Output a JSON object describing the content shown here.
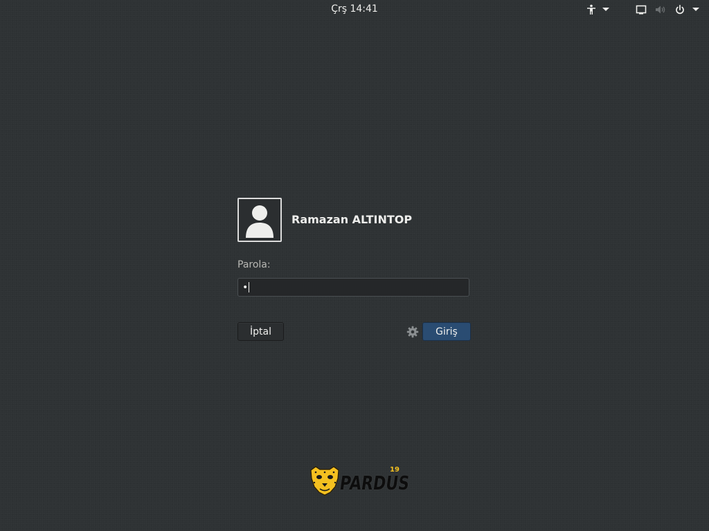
{
  "topbar": {
    "clock": "Çrş 14:41",
    "icons": [
      "accessibility-icon",
      "display-icon",
      "volume-icon",
      "power-icon"
    ]
  },
  "login": {
    "user_name": "Ramazan ALTINTOP",
    "prompt_label": "Parola:",
    "password_mask": "•",
    "cancel_label": "İptal",
    "login_label": "Giriş"
  },
  "branding": {
    "product": "PARDUS",
    "version": "19",
    "logo_color": "#f4c020"
  },
  "colors": {
    "background": "#2e3234",
    "accent": "#2a4c72",
    "text": "#eeeeec"
  }
}
